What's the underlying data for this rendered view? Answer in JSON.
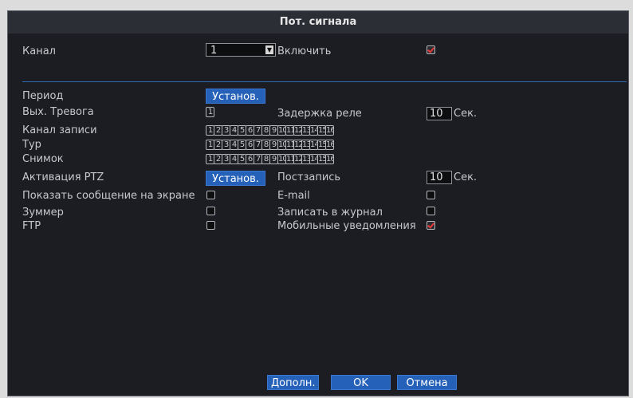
{
  "dialog": {
    "title": "Пот. сигнала",
    "channel_label": "Канал",
    "channel_value": "1",
    "enable_label": "Включить",
    "enable_checked": true,
    "period_label": "Период",
    "set_button": "Установ.",
    "alarm_out_label": "Вых. Тревога",
    "alarm_out_value": "1",
    "relay_delay_label": "Задержка реле",
    "relay_delay_value": "10",
    "sec_label": "Сек.",
    "record_channel_label": "Канал записи",
    "tour_label": "Тур",
    "snapshot_label": "Снимок",
    "channels": [
      "1",
      "2",
      "3",
      "4",
      "5",
      "6",
      "7",
      "8",
      "9",
      "10",
      "11",
      "12",
      "13",
      "14",
      "15",
      "16"
    ],
    "ptz_label": "Активация PTZ",
    "ptz_button": "Установ.",
    "post_record_label": "Постзапись",
    "post_record_value": "10",
    "post_record_unit": "Сек.",
    "show_message_label": "Показать сообщение на экране",
    "show_message_checked": false,
    "email_label": "E-mail",
    "email_checked": false,
    "buzzer_label": "Зуммер",
    "buzzer_checked": false,
    "log_label": "Записать в журнал",
    "log_checked": false,
    "ftp_label": "FTP",
    "ftp_checked": false,
    "mobile_label": "Мобильные уведомления",
    "mobile_checked": true,
    "advanced_button": "Дополн.",
    "ok_button": "OK",
    "cancel_button": "Отмена",
    "colors": {
      "accent": "#2561b8",
      "background": "#1b1d22",
      "check": "#e63a3a"
    }
  }
}
